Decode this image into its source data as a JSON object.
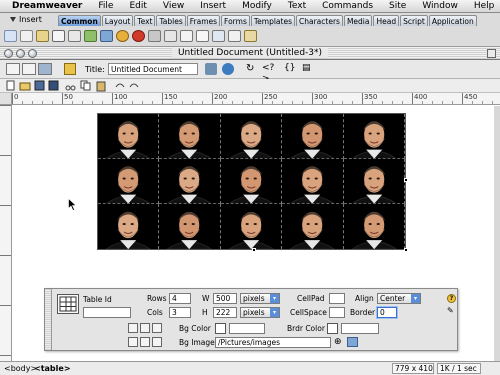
{
  "menubar": {
    "items": [
      "Dreamweaver",
      "File",
      "Edit",
      "View",
      "Insert",
      "Modify",
      "Text",
      "Commands",
      "Site",
      "Window",
      "Help"
    ]
  },
  "insert_bar": {
    "title": "Insert",
    "tabs": [
      "Common",
      "Layout",
      "Text",
      "Tables",
      "Frames",
      "Forms",
      "Templates",
      "Characters",
      "Media",
      "Head",
      "Script",
      "Application"
    ],
    "active_tab": "Common"
  },
  "document": {
    "window_title": "Untitled Document (Untitled-3*)",
    "title_label": "Title:",
    "title_value": "Untitled Document",
    "ruler_labels": [
      "0",
      "50",
      "100",
      "150",
      "200",
      "250",
      "300",
      "350",
      "400",
      "450"
    ]
  },
  "property_inspector": {
    "table_id_label": "Table Id",
    "rows_label": "Rows",
    "rows_value": "4",
    "cols_label": "Cols",
    "cols_value": "3",
    "w_label": "W",
    "w_value": "500",
    "w_unit": "pixels",
    "h_label": "H",
    "h_value": "222",
    "h_unit": "pixels",
    "cellpad_label": "CellPad",
    "cellpad_value": "",
    "cellspace_label": "CellSpace",
    "cellspace_value": "",
    "align_label": "Align",
    "align_value": "Center",
    "border_label": "Border",
    "border_value": "0",
    "bgcolor_label": "Bg Color",
    "brdrcolor_label": "Brdr Color",
    "bgimage_label": "Bg Image",
    "bgimage_value": "/Pictures/images"
  },
  "status_bar": {
    "tag_body": "<body>",
    "tag_table": "<table>",
    "window_size": "779 x 410",
    "download": "1K / 1 sec"
  },
  "colors": {
    "active_tab": "#6f9fdc",
    "image_background": "#000000",
    "focus": "#3a6fd0"
  }
}
